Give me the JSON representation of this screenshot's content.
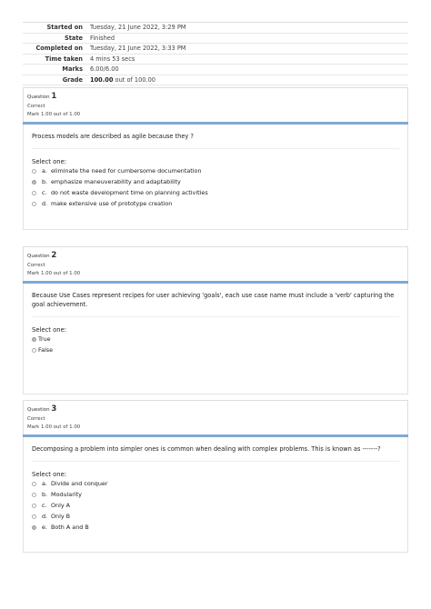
{
  "summary": [
    {
      "label": "Started on",
      "value": "Tuesday, 21 June 2022, 3:29 PM"
    },
    {
      "label": "State",
      "value": "Finished"
    },
    {
      "label": "Completed on",
      "value": "Tuesday, 21 June 2022, 3:33 PM"
    },
    {
      "label": "Time taken",
      "value": "4 mins 53 secs"
    },
    {
      "label": "Marks",
      "value": "6.00/6.00"
    },
    {
      "label": "Grade",
      "value_bold": "100.00",
      "value_rest": " out of 100.00"
    }
  ],
  "questions": [
    {
      "label": "Question",
      "number": "1",
      "state": "Correct",
      "mark": "Mark 1.00 out of 1.00",
      "text": "Process models are described as agile because they ?",
      "prompt": "Select one:",
      "options": [
        {
          "letter": "a.",
          "text": "eliminate the need for cumbersome documentation",
          "selected": false
        },
        {
          "letter": "b.",
          "text": "emphasize maneuverability and adaptability",
          "selected": true
        },
        {
          "letter": "c.",
          "text": "do not waste development time on planning activities",
          "selected": false
        },
        {
          "letter": "d.",
          "text": "make extensive use of prototype creation",
          "selected": false
        }
      ]
    },
    {
      "label": "Question",
      "number": "2",
      "state": "Correct",
      "mark": "Mark 1.00 out of 1.00",
      "text": "Because Use Cases represent recipes for user achieving 'goals', each use case name must include a 'verb' capturing the goal achievement.",
      "prompt": "Select one:",
      "options": [
        {
          "letter": "",
          "text": "True",
          "selected": true
        },
        {
          "letter": "",
          "text": "False",
          "selected": false
        }
      ]
    },
    {
      "label": "Question",
      "number": "3",
      "state": "Correct",
      "mark": "Mark 1.00 out of 1.00",
      "text": "Decomposing a problem into simpler ones is common when dealing with complex problems. This is known as -------?",
      "prompt": "Select one:",
      "options": [
        {
          "letter": "a.",
          "text": "Divide and conquer",
          "selected": false
        },
        {
          "letter": "b.",
          "text": "Modularity",
          "selected": false
        },
        {
          "letter": "c.",
          "text": "Only A",
          "selected": false
        },
        {
          "letter": "d.",
          "text": "Only B",
          "selected": false
        },
        {
          "letter": "e.",
          "text": "Both A and B",
          "selected": true
        }
      ]
    }
  ]
}
